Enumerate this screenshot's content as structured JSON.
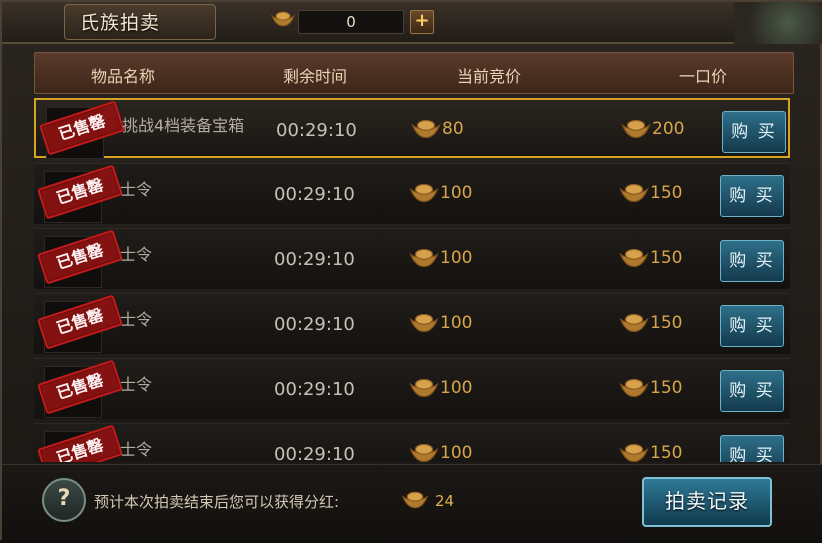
{
  "window": {
    "title": "氏族拍卖"
  },
  "currency": {
    "amount": "0",
    "add_label": "+"
  },
  "table": {
    "headers": [
      "物品名称",
      "剩余时间",
      "当前竞价",
      "一口价"
    ],
    "rows": [
      {
        "name": "挑战4档装备宝箱",
        "stamp": "已售罄",
        "time": "00:29:10",
        "current_bid": "80",
        "buyout": "200",
        "buy_label": "购 买",
        "selected": true
      },
      {
        "name": "士令",
        "stamp": "已售罄",
        "time": "00:29:10",
        "current_bid": "100",
        "buyout": "150",
        "buy_label": "购 买"
      },
      {
        "name": "士令",
        "stamp": "已售罄",
        "time": "00:29:10",
        "current_bid": "100",
        "buyout": "150",
        "buy_label": "购 买"
      },
      {
        "name": "士令",
        "stamp": "已售罄",
        "time": "00:29:10",
        "current_bid": "100",
        "buyout": "150",
        "buy_label": "购 买"
      },
      {
        "name": "士令",
        "stamp": "已售罄",
        "time": "00:29:10",
        "current_bid": "100",
        "buyout": "150",
        "buy_label": "购 买"
      },
      {
        "name": "士令",
        "stamp": "已售罄",
        "time": "00:29:10",
        "current_bid": "100",
        "buyout": "150",
        "buy_label": "购 买"
      }
    ]
  },
  "footer": {
    "help_label": "?",
    "tip_text": "预计本次拍卖结束后您可以获得分红:",
    "dividend": "24",
    "record_button": "拍卖记录"
  },
  "colors": {
    "accent_gold": "#d7a422",
    "button_teal": "#2e6f89",
    "stamp_red": "#c11a1a"
  },
  "icons": {
    "currency": "gold-ingot-icon",
    "help": "question-icon"
  }
}
